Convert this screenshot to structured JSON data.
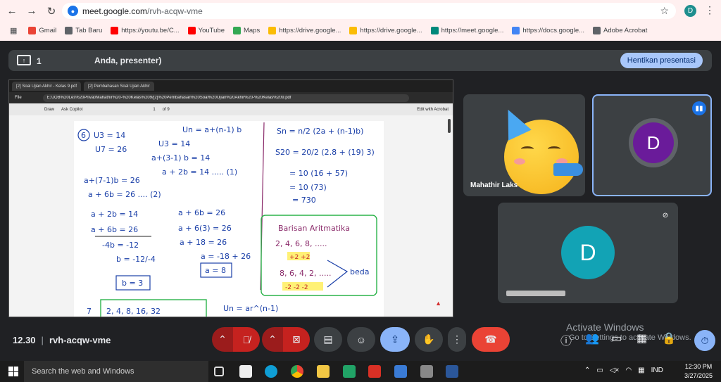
{
  "browser": {
    "url_host": "meet.google.com",
    "url_path": "/rvh-acqw-vme",
    "profile_initial": "D",
    "bookmarks": [
      {
        "label": "Gmail",
        "color": "#ea4335"
      },
      {
        "label": "Tab Baru",
        "color": "#5f6368"
      },
      {
        "label": "https://youtu.be/C...",
        "color": "#ff0000"
      },
      {
        "label": "YouTube",
        "color": "#ff0000"
      },
      {
        "label": "Maps",
        "color": "#34a853"
      },
      {
        "label": "https://drive.google...",
        "color": "#fbbc04"
      },
      {
        "label": "https://drive.google...",
        "color": "#fbbc04"
      },
      {
        "label": "https://meet.google...",
        "color": "#00897b"
      },
      {
        "label": "https://docs.google...",
        "color": "#4285f4"
      },
      {
        "label": "Adobe Acrobat",
        "color": "#5f6368"
      }
    ]
  },
  "presentation": {
    "count": "1",
    "title": "Anda, presenter)",
    "stop_label": "Hentikan presentasi"
  },
  "shared_screen": {
    "tab1": "[2] Soal Ujian Akhir - Kelas 9.pdf",
    "tab2": "[2] Pembahasan Soal Ujian Akhir",
    "file_label": "File",
    "path": "E:/JOB%20Les%20Privat/Mahathir%20-%20Kelas%209/[2]%20Pembahasan%20Soal%20Ujian%20Akhir%20-%20Kelas%209.pdf",
    "draw_label": "Draw",
    "ask_copilot": "Ask Copilot",
    "page_num": "1",
    "page_total": "of 9",
    "edit_acrobat": "Edit with Acrobat",
    "notes": {
      "q6": "6",
      "l1": "U3 = 14",
      "l2": "U7 = 26",
      "l3": "a+(7-1)b = 26",
      "l4": "a + 6b = 26 .... (2)",
      "m1": "Un = a+(n-1) b",
      "m2": "U3 = 14",
      "m3": "a+(3-1) b = 14",
      "m4": "a + 2b = 14 ..... (1)",
      "r1": "Sn = n/2 (2a + (n-1)b)",
      "r2": "S20 = 20/2 (2.8 + (19) 3)",
      "r3": "= 10 (16 + 57)",
      "r4": "= 10 (73)",
      "r5": "= 730",
      "e1": "a + 2b = 14",
      "e2": "a + 6b = 26",
      "e3": "-4b = -12",
      "e4": "b = -12/-4",
      "e5": "b = 3",
      "f1": "a + 6b = 26",
      "f2": "a + 6(3) = 26",
      "f3": "a + 18 = 26",
      "f4": "a = -18 + 26",
      "f5": "a = 8",
      "box_title": "Barisan Aritmatika",
      "box1": "2, 4, 6, 8, .....",
      "box1b": "+2 +2",
      "box2": "8, 6, 4, 2, .....",
      "box2b": "-2 -2 -2",
      "beda": "beda",
      "q7": "7",
      "q7seq": "2, 4, 8, 16, 32",
      "q7f": "Un = ar^(n-1)"
    }
  },
  "participants": {
    "tile1_name": "Mahathir Laks",
    "tile2_initial": "D",
    "tile3_initial": "D"
  },
  "controls": {
    "time": "12.30",
    "meeting_code": "rvh-acqw-vme"
  },
  "watermark": {
    "line1": "Activate Windows",
    "line2": "Go to Settings to activate Windows."
  },
  "taskbar": {
    "search_placeholder": "Search the web and Windows",
    "lang": "IND",
    "time": "12:30 PM",
    "date": "3/27/2025"
  }
}
